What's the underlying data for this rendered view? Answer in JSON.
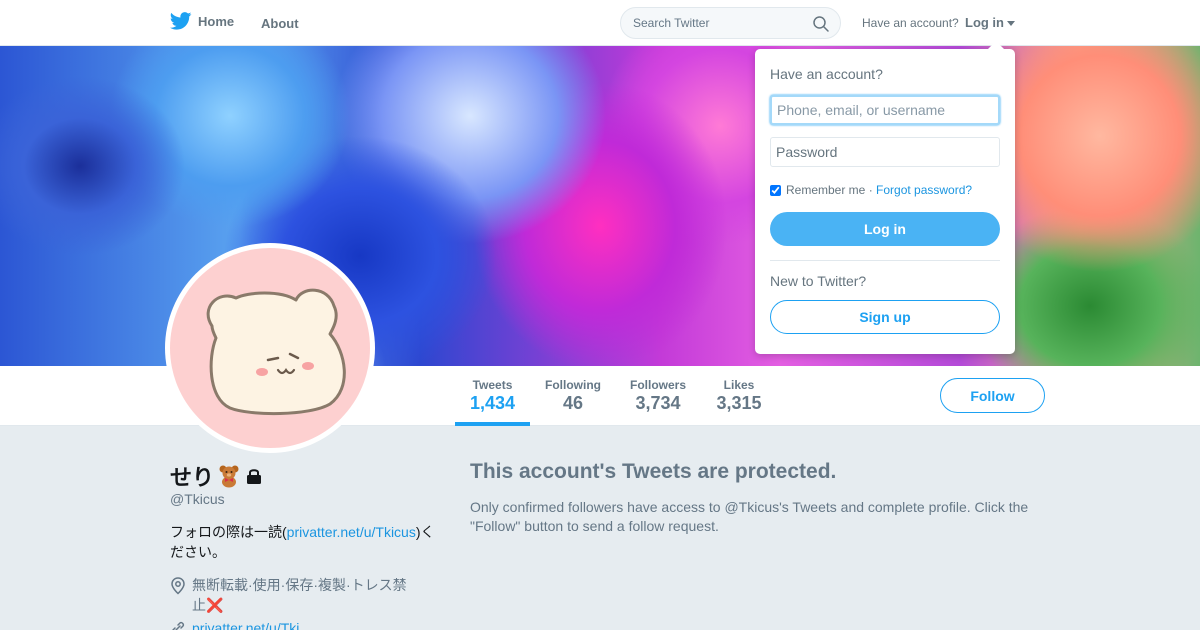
{
  "nav": {
    "home_label": "Home",
    "about_label": "About",
    "search_placeholder": "Search Twitter",
    "have_account": "Have an account?",
    "login_label": "Log in"
  },
  "profile_nav": {
    "stats": [
      {
        "label": "Tweets",
        "value": "1,434"
      },
      {
        "label": "Following",
        "value": "46"
      },
      {
        "label": "Followers",
        "value": "3,734"
      },
      {
        "label": "Likes",
        "value": "3,315"
      }
    ],
    "follow_label": "Follow"
  },
  "profile": {
    "name": "せり",
    "screen_name": "@Tkicus",
    "bio_prefix": "フォロの際は一読(",
    "bio_link": "privatter.net/u/Tkicus",
    "bio_suffix": ")ください。",
    "location": "無断転載·使用·保存·複製·トレス禁止❌",
    "url": "privatter.net/u/Tki..."
  },
  "protected": {
    "title": "This account's Tweets are protected.",
    "text": "Only confirmed followers have access to @Tkicus's Tweets and complete profile. Click the \"Follow\" button to send a follow request."
  },
  "login_dropdown": {
    "heading": "Have an account?",
    "username_placeholder": "Phone, email, or username",
    "password_placeholder": "Password",
    "remember_label": "Remember me",
    "separator": " · ",
    "forgot_label": "Forgot password?",
    "login_button": "Log in",
    "new_label": "New to Twitter?",
    "signup_button": "Sign up"
  },
  "colors": {
    "brand": "#1da1f2",
    "muted": "#657786",
    "background": "#e6ecf0"
  }
}
